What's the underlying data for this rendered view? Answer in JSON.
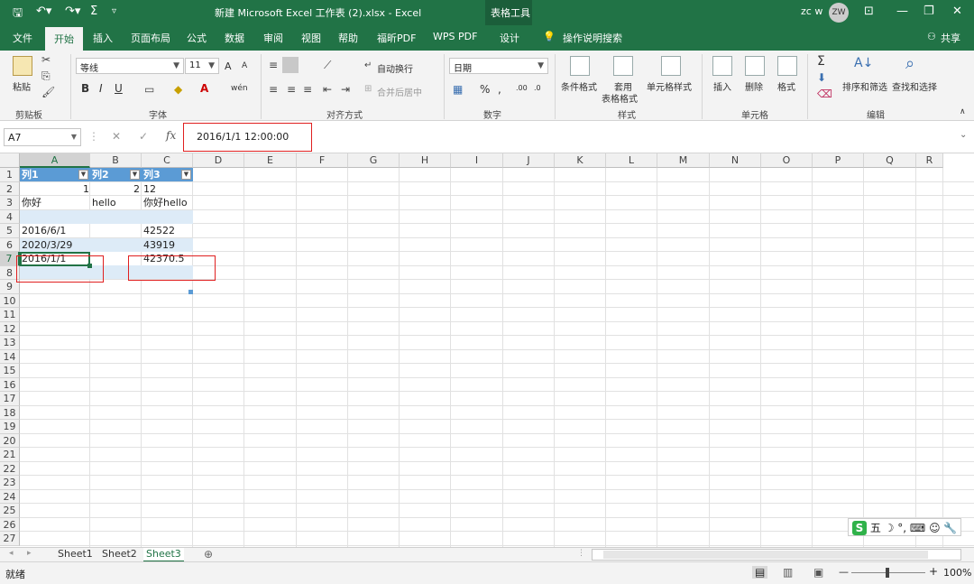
{
  "titlebar": {
    "title": "新建 Microsoft Excel 工作表 (2).xlsx  -  Excel",
    "context_tool": "表格工具",
    "user": "zc w",
    "avatar": "ZW"
  },
  "tabs": [
    "文件",
    "开始",
    "插入",
    "页面布局",
    "公式",
    "数据",
    "审阅",
    "视图",
    "帮助",
    "福昕PDF",
    "WPS PDF",
    "设计"
  ],
  "active_tab": "开始",
  "tell_me": "操作说明搜索",
  "share": "共享",
  "ribbon": {
    "clipboard": {
      "label": "剪贴板",
      "paste": "粘贴"
    },
    "font": {
      "label": "字体",
      "name": "等线",
      "size": "11",
      "bold": "B",
      "italic": "I",
      "underline": "U",
      "grow": "A",
      "shrink": "A",
      "phonetic": "wén"
    },
    "alignment": {
      "label": "对齐方式",
      "wrap": "自动换行",
      "merge": "合并后居中"
    },
    "number": {
      "label": "数字",
      "format": "日期",
      "percent": "%"
    },
    "styles": {
      "label": "样式",
      "conditional": "条件格式",
      "table": "套用",
      "table2": "表格格式",
      "cell_styles": "单元格样式"
    },
    "cells": {
      "label": "单元格",
      "insert": "插入",
      "delete": "删除",
      "format": "格式"
    },
    "editing": {
      "label": "编辑",
      "sort": "排序和筛选",
      "find": "查找和选择",
      "sigma": "Σ"
    }
  },
  "formula_bar": {
    "name_box": "A7",
    "fx": "fx",
    "value": "2016/1/1  12:00:00"
  },
  "columns": [
    "A",
    "B",
    "C",
    "D",
    "E",
    "F",
    "G",
    "H",
    "I",
    "J",
    "K",
    "L",
    "M",
    "N",
    "O",
    "P",
    "Q",
    "R"
  ],
  "rows": [
    "1",
    "2",
    "3",
    "4",
    "5",
    "6",
    "7",
    "8",
    "9",
    "10",
    "11",
    "12",
    "13",
    "14",
    "15",
    "16",
    "17",
    "18",
    "19",
    "20",
    "21",
    "22",
    "23",
    "24",
    "25",
    "26",
    "27"
  ],
  "table": {
    "headers": [
      "列1",
      "列2",
      "列3"
    ],
    "cells": {
      "B2": "1",
      "B2b": "2",
      "C2": "12",
      "A3": "你好",
      "B3": "hello",
      "C3": "你好hello",
      "A5": "2016/6/1",
      "C5": "42522",
      "A6": "2020/3/29",
      "C6": "43919",
      "A7": "2016/1/1",
      "C7": "42370.5"
    }
  },
  "sheets": [
    "Sheet1",
    "Sheet2",
    "Sheet3"
  ],
  "active_sheet": "Sheet3",
  "status": {
    "mode": "就绪",
    "zoom": "100%"
  },
  "ime": {
    "label": "五"
  },
  "colors": {
    "excel_green": "#217346",
    "table_header": "#5b9bd5",
    "table_band": "#ddebf7",
    "annotation_red": "#e02020"
  }
}
